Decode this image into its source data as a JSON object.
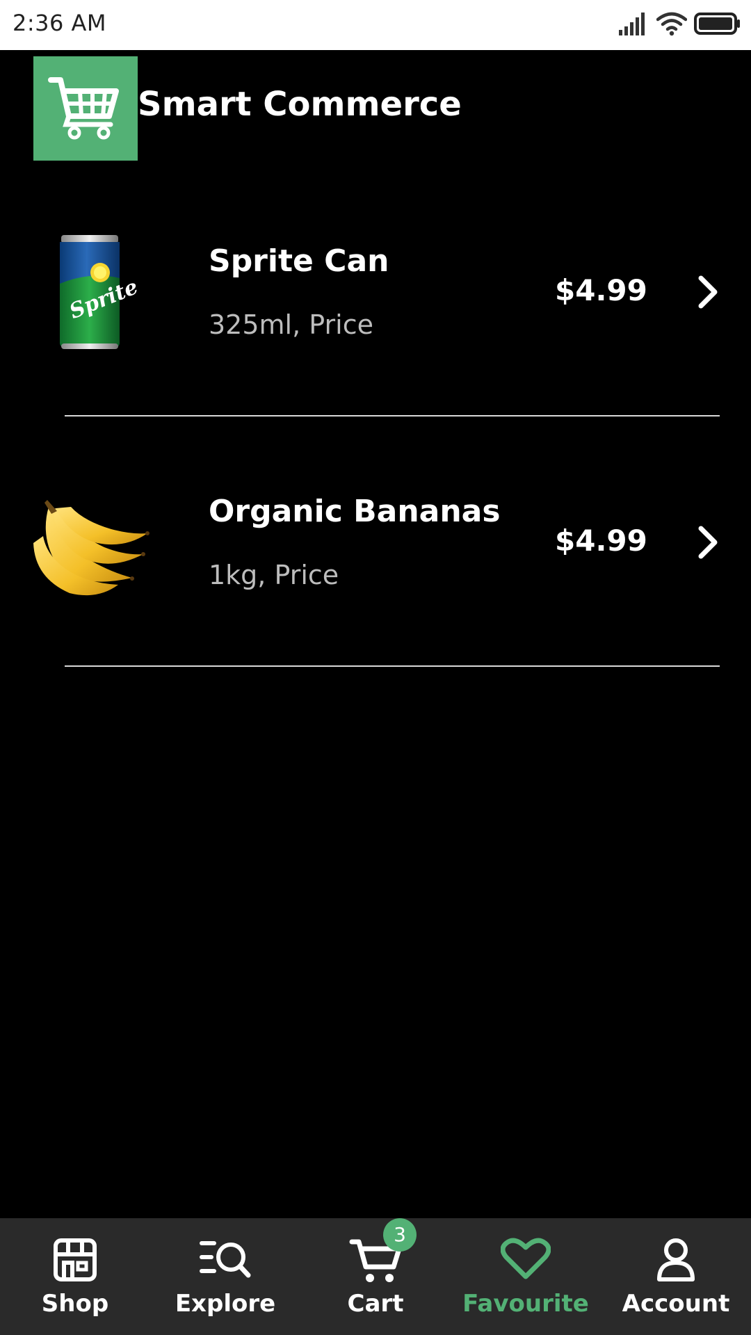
{
  "status_bar": {
    "time": "2:36 AM",
    "icons": [
      "signal-icon",
      "wifi-icon",
      "battery-icon"
    ]
  },
  "header": {
    "logo_icon": "cart-icon",
    "title": "Smart Commerce"
  },
  "colors": {
    "accent": "#53b175",
    "background": "#000000",
    "nav_background": "#2a2a2a",
    "status_bar": "#ffffff"
  },
  "products": [
    {
      "image": "sprite-can-image",
      "name": "Sprite Can",
      "detail": "325ml, Price",
      "price": "$4.99"
    },
    {
      "image": "organic-bananas-image",
      "name": "Organic Bananas",
      "detail": "1kg, Price",
      "price": "$4.99"
    }
  ],
  "bottom_nav": {
    "items": [
      {
        "label": "Shop",
        "icon": "store-icon",
        "active": false
      },
      {
        "label": "Explore",
        "icon": "explore-icon",
        "active": false
      },
      {
        "label": "Cart",
        "icon": "cart-icon",
        "active": false,
        "badge": "3"
      },
      {
        "label": "Favourite",
        "icon": "heart-icon",
        "active": true
      },
      {
        "label": "Account",
        "icon": "user-icon",
        "active": false
      }
    ]
  }
}
